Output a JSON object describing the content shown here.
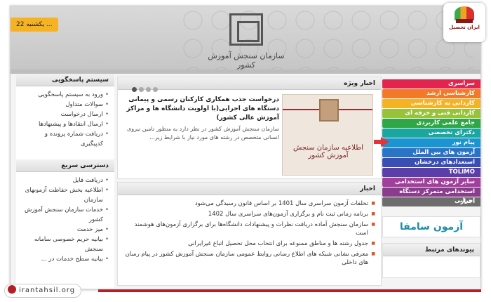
{
  "header": {
    "date": "یکشنبه 22 ...",
    "logo_text": "سازمان سنجش آموزش کشور"
  },
  "brand": {
    "name": "ایران تحصیل"
  },
  "left": {
    "response_system": {
      "title": "سیستم پاسخگویی",
      "items": [
        "ورود به سیستم پاسخگویی",
        "سوالات متداول",
        "ارسال درخواست",
        "ارسال انتقادها و پیشنهادها",
        "دریافت شماره پرونده و کدپیگیری"
      ]
    },
    "quick_access": {
      "title": "دسترسی سریع",
      "items": [
        "دریافت فایل",
        "اطلاعیه بخش حفاظت آزمونهای سازمان",
        "خدمات سازمان سنجش آموزش کشور",
        "میز خدمت",
        "بیانیه حریم خصوصی سامانه سنجش",
        "بیانیه سطح خدمات در ..."
      ]
    }
  },
  "center": {
    "featured": {
      "title": "اخبار ویژه",
      "headline": "درخواست جذب همکاری کارکنان رسمی و پیمانی دستگاه های اجرایی(با اولویت دانشگاه ها و مراکز آموزش عالی کشور)",
      "body": "سازمان سنجش آموزش کشور در نظر دارد به منظور تامین نیروی انسانی متخصص در رشته های مورد نیاز با شرایط زیر...",
      "image_text": "اطلاعیه سازمان سنجش آموزش کشور"
    },
    "news": {
      "title": "اخبار",
      "items": [
        "تخلفات آزمون سراسری سال 1401 بر اساس قانون رسیدگی می‌شود",
        "برنامه زمانی ثبت نام و برگزاری آزمون‌های سراسری سال 1402",
        "سازمان سنجش آماده دریافت نظرات و پیشنهادات دانشگاه‌ها برای برگزاری آزمون‌های هوشمند است",
        "جدول رشته ها و مناطق ممنوعه برای انتخاب محل تحصیل اتباع غیرایرانی",
        "معرفی نشانی شبکه های اطلاع رسانی روابط عمومی سازمان سنجش آموزش کشور در پیام رسان های داخلی"
      ]
    }
  },
  "right": {
    "menu": [
      {
        "label": "سراسری",
        "color": "#e2254f"
      },
      {
        "label": "کارشناسی ارشد",
        "color": "#f3792a"
      },
      {
        "label": "کاردانی به کارشناسی",
        "color": "#f3b325"
      },
      {
        "label": "کاردانی فنی و حرفه ای",
        "color": "#97c23a"
      },
      {
        "label": "جامع علمی کاربردی",
        "color": "#2fa748"
      },
      {
        "label": "دکترای تخصصی",
        "color": "#1aa7a0"
      },
      {
        "label": "پیام نور",
        "color": "#1b95d2"
      },
      {
        "label": "آزمون های بین الملل",
        "color": "#2a74c6"
      },
      {
        "label": "استعدادهای درخشان",
        "color": "#3a4fb4"
      },
      {
        "label": "TOLIMO",
        "color": "#5b3ea8"
      },
      {
        "label": "سایر آزمون های استخدامی",
        "color": "#a23f9d"
      },
      {
        "label": "استخدامی متمرکز دستگاه اجرایی",
        "color": "#8a3d8d"
      },
      {
        "label": "اخبار",
        "color": "#6d6d6d"
      }
    ],
    "partner": "آزمون سامفا",
    "related_title": "پیوندهای مرتبط"
  },
  "footer": {
    "site": "irantahsil.org"
  }
}
